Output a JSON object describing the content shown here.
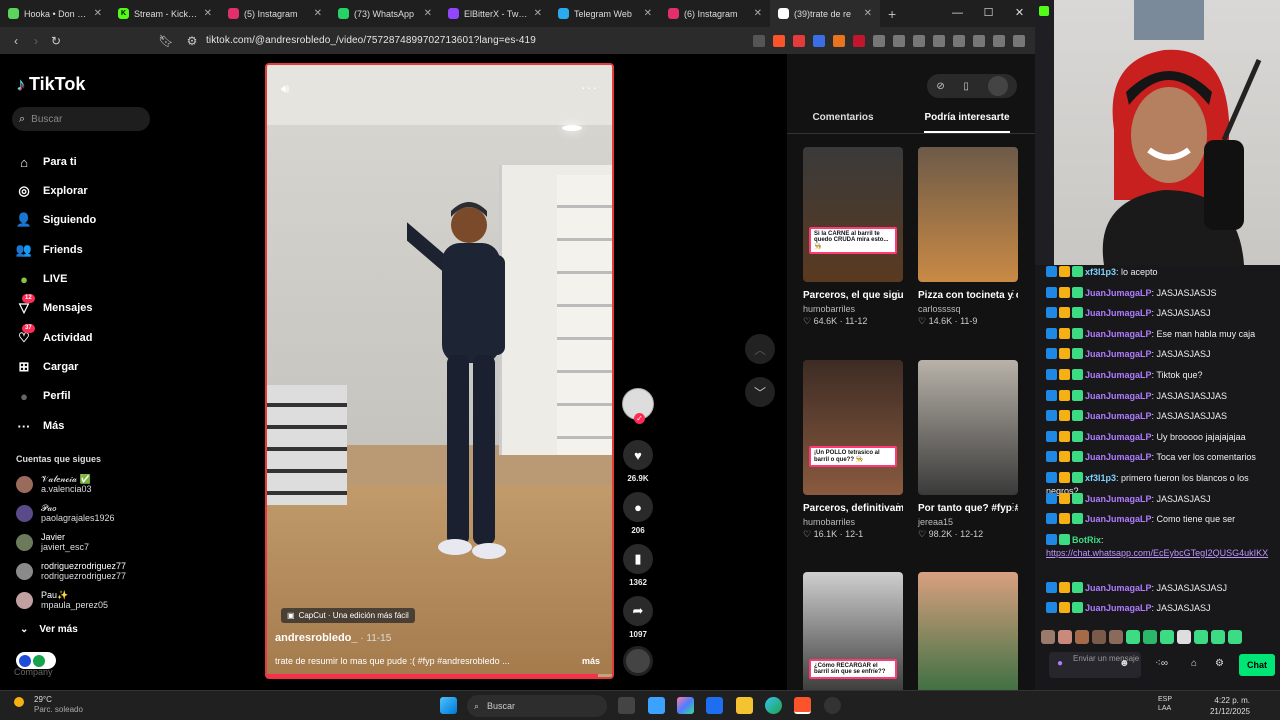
{
  "browser": {
    "tabs": [
      {
        "label": "Hooka • Don Ome",
        "color": "#5ad45a",
        "glyph": ""
      },
      {
        "label": "Stream - Kick Das",
        "color": "#53fc18",
        "glyph": "K"
      },
      {
        "label": "(5) Instagram",
        "color": "#e1306c",
        "glyph": ""
      },
      {
        "label": "(73) WhatsApp",
        "color": "#25d366",
        "glyph": ""
      },
      {
        "label": "ElBitterX - Twitch",
        "color": "#9146ff",
        "glyph": ""
      },
      {
        "label": "Telegram Web",
        "color": "#2aabee",
        "glyph": ""
      },
      {
        "label": "(6) Instagram",
        "color": "#e1306c",
        "glyph": ""
      },
      {
        "label": "(39)trate de re",
        "color": "#ffffff",
        "glyph": ""
      }
    ],
    "url": "tiktok.com/@andresrobledo_/video/7572874899702713601?lang=es-419"
  },
  "tiktok": {
    "logo": "TikTok",
    "search_placeholder": "Buscar",
    "nav": [
      {
        "label": "Para ti",
        "icon": "home-icon",
        "glyph": "⌂",
        "badge": ""
      },
      {
        "label": "Explorar",
        "icon": "compass-icon",
        "glyph": "◎",
        "badge": ""
      },
      {
        "label": "Siguiendo",
        "icon": "following-icon",
        "glyph": "👤",
        "badge": ""
      },
      {
        "label": "Friends",
        "icon": "friends-icon",
        "glyph": "👥",
        "badge": ""
      },
      {
        "label": "LIVE",
        "icon": "live-icon",
        "glyph": "●",
        "badge": ""
      },
      {
        "label": "Mensajes",
        "icon": "messages-icon",
        "glyph": "▽",
        "badge": "12"
      },
      {
        "label": "Actividad",
        "icon": "activity-icon",
        "glyph": "♡",
        "badge": "37"
      },
      {
        "label": "Cargar",
        "icon": "upload-icon",
        "glyph": "⊞",
        "badge": ""
      },
      {
        "label": "Perfil",
        "icon": "profile-icon",
        "glyph": "●",
        "badge": ""
      },
      {
        "label": "Más",
        "icon": "more-icon",
        "glyph": "···",
        "badge": ""
      }
    ],
    "following_title": "Cuentas que sigues",
    "accounts": [
      {
        "name": "𝒱𝒶𝓁𝑒𝓃𝒸𝒾𝒶 ✅",
        "user": "a.valencia03"
      },
      {
        "name": "𝒫𝒶𝑜",
        "user": "paolagrajales1926"
      },
      {
        "name": "Javier",
        "user": "javiert_esc7"
      },
      {
        "name": "rodriguezrodriguez77",
        "user": "rodriguezrodriguez77"
      },
      {
        "name": "Pau✨",
        "user": "mpaula_perez05"
      }
    ],
    "ver_mas": "Ver más",
    "company": "Company"
  },
  "video": {
    "capcut": "CapCut · Una edición más fácil",
    "author": "andresrobledo_",
    "date": " · 11-15",
    "description": "trate de resumir lo mas que pude :( #fyp #andresrobledo ...",
    "more": "más",
    "progress": 0.96,
    "likes": "26.9K",
    "comments": "206",
    "saves": "1362",
    "shares": "1097"
  },
  "right_panel": {
    "tabs": [
      "Comentarios",
      "Podría interesarte"
    ],
    "cards": [
      {
        "title": "Parceros, el que sigue CONSEJOS...",
        "user": "humobarriles",
        "stats": "♡ 64.6K · 11-12",
        "caption": "Si la CARNE al barril te quedo CRUDA mira esto...👨‍🍳",
        "bg": "linear-gradient(180deg,#3a3a3a,#5a3a20)"
      },
      {
        "title": "Pizza con tocineta y champiñones a...",
        "user": "carlossssq",
        "stats": "♡ 14.6K · 11-9",
        "caption": "",
        "bg": "linear-gradient(180deg,#6d5a48,#c98a45)"
      },
      {
        "title": "Parceros, definitivamente,...",
        "user": "humobarriles",
        "stats": "♡ 16.1K · 12-1",
        "caption": "¡Un POLLO tetrasico al barril o que?? 👨‍🍳",
        "bg": "linear-gradient(180deg,#3d2c24,#8a5a3f)"
      },
      {
        "title": "Por tanto que? #fyp #parati...",
        "user": "jereaa15",
        "stats": "♡ 98.2K · 12-12",
        "caption": "",
        "bg": "linear-gradient(180deg,#b8b2a8,#3a3a3a)"
      },
      {
        "title": "",
        "user": "",
        "stats": "",
        "caption": "¿Cómo RECARGAR el barril sin que se enfríe??",
        "bg": "linear-gradient(180deg,#cfcfcf,#2a2a2a)"
      },
      {
        "title": "",
        "user": "",
        "stats": "",
        "caption": "",
        "bg": "linear-gradient(180deg,#d9a080,#2b6a3a)"
      }
    ]
  },
  "chat": {
    "messages": [
      {
        "user": "xf3l1p3",
        "color": "#7fd3ff",
        "text": ": lo acepto"
      },
      {
        "user": "JuanJumagaLP",
        "color": "#b07cff",
        "text": ": JASJASJASJS"
      },
      {
        "user": "JuanJumagaLP",
        "color": "#b07cff",
        "text": ": JASJASJASJ"
      },
      {
        "user": "JuanJumagaLP",
        "color": "#b07cff",
        "text": ": Ese man habla muy caja"
      },
      {
        "user": "JuanJumagaLP",
        "color": "#b07cff",
        "text": ": JASJASJASJ"
      },
      {
        "user": "JuanJumagaLP",
        "color": "#b07cff",
        "text": ": Tiktok que?"
      },
      {
        "user": "JuanJumagaLP",
        "color": "#b07cff",
        "text": ": JASJASJASJJAS"
      },
      {
        "user": "JuanJumagaLP",
        "color": "#b07cff",
        "text": ": JASJASJASJJAS"
      },
      {
        "user": "JuanJumagaLP",
        "color": "#b07cff",
        "text": ": Uy brooooo jajajajajaa"
      },
      {
        "user": "JuanJumagaLP",
        "color": "#b07cff",
        "text": ": Toca ver los comentarios"
      },
      {
        "user": "xf3l1p3",
        "color": "#7fd3ff",
        "text": ": primero fueron los blancos o los negros?"
      },
      {
        "user": "JuanJumagaLP",
        "color": "#b07cff",
        "text": ": JASJASJASJ"
      },
      {
        "user": "JuanJumagaLP",
        "color": "#b07cff",
        "text": ": Como tiene que ser"
      }
    ],
    "botrix_user": "BotRix",
    "botrix_link": "https://chat.whatsapp.com/EcEybcGTegI2QUSG4ukIKX",
    "messages2": [
      {
        "user": "JuanJumagaLP",
        "color": "#b07cff",
        "text": ": JASJASJASJASJ"
      },
      {
        "user": "JuanJumagaLP",
        "color": "#b07cff",
        "text": ": JASJASJASJ"
      }
    ],
    "input_placeholder": "Enviar un mensaje",
    "send_label": "Chat"
  },
  "taskbar": {
    "temp": "29°C",
    "weather": "Parc. soleado",
    "search": "Buscar",
    "lang": "ESP",
    "lang2": "LAA",
    "time": "4:22 p. m.",
    "date": "21/12/2025"
  }
}
